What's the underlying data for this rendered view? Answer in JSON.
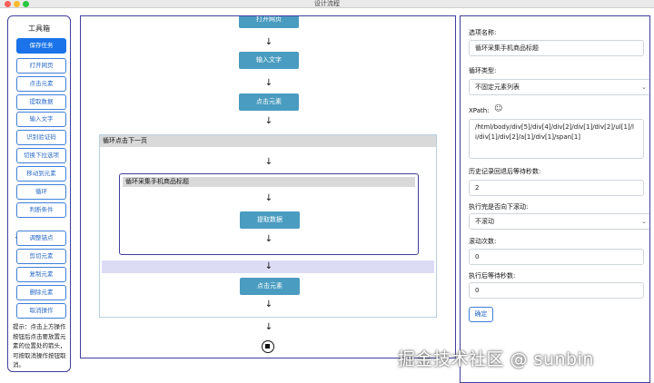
{
  "window": {
    "title": "设计流程"
  },
  "toolbox": {
    "title": "工具箱",
    "buttons": [
      "保存任务",
      "打开网页",
      "点击元素",
      "提取数据",
      "输入文字",
      "识别验证码",
      "切换下拉选项",
      "移动到元素",
      "循环",
      "判断条件"
    ],
    "buttons2": [
      "调整锚点",
      "剪切元素",
      "复制元素",
      "删除元素",
      "取消操作"
    ],
    "hint": "提示：点击上方操作按钮后点击要放置元素的位置处的箭头，可按取消操作按钮取消。"
  },
  "canvas": {
    "node_open_page": "打开网页",
    "node_input_text": "输入文字",
    "node_click_1": "点击元素",
    "loop_outer_title": "循环点击下一页",
    "loop_inner_title": "循环采集手机商品标题",
    "node_extract": "提取数据",
    "node_click_2": "点击元素",
    "arrow": "↓"
  },
  "options": {
    "name_label": "选项名称:",
    "name_value": "循环采集手机商品标题",
    "loop_type_label": "循环类型:",
    "loop_type_value": "不固定元素列表",
    "xpath_label": "XPath:",
    "xpath_value": "/html/body/div[5]/div[4]/div[2]/div[1]/div[2]/ul[1]/li/div[1]/div[2]/a[1]/div[1]/span[1]",
    "wait_history_label": "历史记录回退后等待秒数:",
    "wait_history_value": "2",
    "scroll_label": "执行完是否向下滚动:",
    "scroll_value": "不滚动",
    "scroll_count_label": "滚动次数:",
    "scroll_count_value": "0",
    "wait_after_label": "执行后等待秒数:",
    "wait_after_value": "0",
    "confirm": "确定"
  },
  "watermark": "掘金技术社区 @ sunbin",
  "colors": {
    "primary": "#1a73e8",
    "node": "#4a9cc0",
    "border": "#3f3f9c",
    "loop_header": "#d9d9d9",
    "drop_zone": "#dcdcf5"
  }
}
